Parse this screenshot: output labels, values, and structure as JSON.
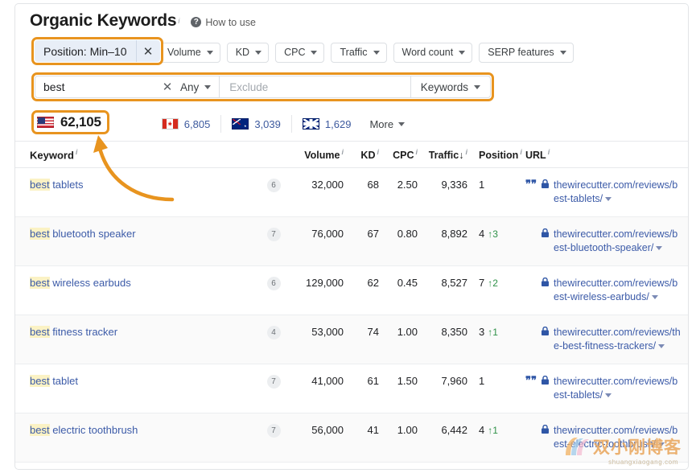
{
  "header": {
    "title": "Organic Keywords",
    "title_info": "i",
    "how_to_use": "How to use",
    "help_icon": "question-circle-icon"
  },
  "filters": {
    "position_pill": {
      "label": "Position: Min–10",
      "close_icon": "✕"
    },
    "buttons": [
      {
        "label": "Volume"
      },
      {
        "label": "KD"
      },
      {
        "label": "CPC"
      },
      {
        "label": "Traffic"
      },
      {
        "label": "Word count"
      },
      {
        "label": "SERP features"
      }
    ]
  },
  "search": {
    "include_value": "best",
    "clear_icon": "✕",
    "match_mode": "Any",
    "exclude_placeholder": "Exclude",
    "exclude_value": "",
    "target": "Keywords"
  },
  "countries": {
    "tabs": [
      {
        "flag": "us-flag",
        "count": "62,105",
        "selected": true
      },
      {
        "flag": "ca-flag",
        "count": "6,805",
        "selected": false
      },
      {
        "flag": "au-flag",
        "count": "3,039",
        "selected": false
      },
      {
        "flag": "gb-flag",
        "count": "1,629",
        "selected": false
      }
    ],
    "more_label": "More"
  },
  "table": {
    "columns": [
      {
        "key": "keyword",
        "label": "Keyword",
        "info": "i"
      },
      {
        "key": "volume",
        "label": "Volume",
        "info": "i"
      },
      {
        "key": "kd",
        "label": "KD",
        "info": "i"
      },
      {
        "key": "cpc",
        "label": "CPC",
        "info": "i"
      },
      {
        "key": "traffic",
        "label": "Traffic",
        "info": "i",
        "sort": "↓"
      },
      {
        "key": "position",
        "label": "Position",
        "info": "i"
      },
      {
        "key": "url",
        "label": "URL",
        "info": "i"
      }
    ],
    "rows": [
      {
        "keyword_highlight": "best",
        "keyword_rest": " tablets",
        "serp_features": "6",
        "volume": "32,000",
        "kd": "68",
        "cpc": "2.50",
        "traffic": "9,336",
        "position": "1",
        "position_change": "",
        "has_quote_icon": true,
        "url": "thewirecutter.com/reviews/best-tablets/"
      },
      {
        "keyword_highlight": "best",
        "keyword_rest": " bluetooth speaker",
        "serp_features": "7",
        "volume": "76,000",
        "kd": "67",
        "cpc": "0.80",
        "traffic": "8,892",
        "position": "4",
        "position_change": "↑3",
        "has_quote_icon": false,
        "url": "thewirecutter.com/reviews/best-bluetooth-speaker/"
      },
      {
        "keyword_highlight": "best",
        "keyword_rest": " wireless earbuds",
        "serp_features": "6",
        "volume": "129,000",
        "kd": "62",
        "cpc": "0.45",
        "traffic": "8,527",
        "position": "7",
        "position_change": "↑2",
        "has_quote_icon": false,
        "url": "thewirecutter.com/reviews/best-wireless-earbuds/"
      },
      {
        "keyword_highlight": "best",
        "keyword_rest": " fitness tracker",
        "serp_features": "4",
        "volume": "53,000",
        "kd": "74",
        "cpc": "1.00",
        "traffic": "8,350",
        "position": "3",
        "position_change": "↑1",
        "has_quote_icon": false,
        "url": "thewirecutter.com/reviews/the-best-fitness-trackers/"
      },
      {
        "keyword_highlight": "best",
        "keyword_rest": " tablet",
        "serp_features": "7",
        "volume": "41,000",
        "kd": "61",
        "cpc": "1.50",
        "traffic": "7,960",
        "position": "1",
        "position_change": "",
        "has_quote_icon": true,
        "url": "thewirecutter.com/reviews/best-tablets/"
      },
      {
        "keyword_highlight": "best",
        "keyword_rest": " electric toothbrush",
        "serp_features": "7",
        "volume": "56,000",
        "kd": "41",
        "cpc": "1.00",
        "traffic": "6,442",
        "position": "4",
        "position_change": "↑1",
        "has_quote_icon": false,
        "url": "thewirecutter.com/reviews/best-electric-toothbrush/"
      }
    ]
  },
  "watermark": {
    "text": "双小刚博客",
    "url": "shuangxiaogang.com"
  },
  "colors": {
    "annotation": "#e8941f",
    "link": "#3c5ba8",
    "highlight": "#fbf2c4",
    "positive": "#2e9148"
  }
}
